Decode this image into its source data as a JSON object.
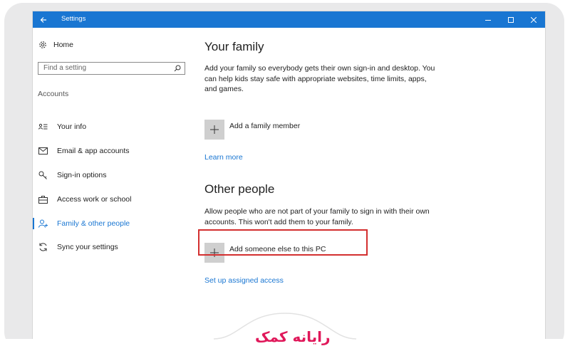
{
  "window": {
    "title": "Settings"
  },
  "sidebar": {
    "home_label": "Home",
    "search_placeholder": "Find a setting",
    "section_label": "Accounts",
    "items": [
      {
        "label": "Your info",
        "icon": "person-card-icon",
        "active": false
      },
      {
        "label": "Email & app accounts",
        "icon": "mail-icon",
        "active": false
      },
      {
        "label": "Sign-in options",
        "icon": "key-icon",
        "active": false
      },
      {
        "label": "Access work or school",
        "icon": "briefcase-icon",
        "active": false
      },
      {
        "label": "Family & other people",
        "icon": "people-icon",
        "active": true
      },
      {
        "label": "Sync your settings",
        "icon": "sync-icon",
        "active": false
      }
    ]
  },
  "main": {
    "family": {
      "title": "Your family",
      "description": "Add your family so everybody gets their own sign-in and desktop. You can help kids stay safe with appropriate websites, time limits, apps, and games.",
      "add_label": "Add a family member",
      "learn_more": "Learn more"
    },
    "other": {
      "title": "Other people",
      "description": "Allow people who are not part of your family to sign in with their own accounts. This won't add them to your family.",
      "add_label": "Add someone else to this PC",
      "assigned_access": "Set up assigned access"
    }
  },
  "watermark": {
    "logo_text": "رایانه کمک"
  },
  "colors": {
    "accent": "#1976d2",
    "highlight": "#d32f2f",
    "brand": "#e0185a"
  }
}
